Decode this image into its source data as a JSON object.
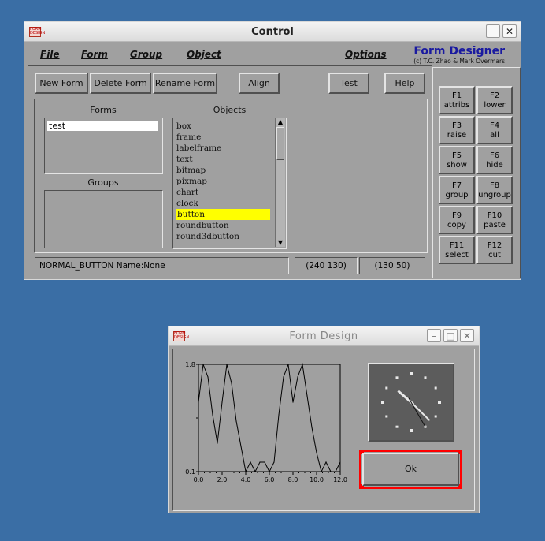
{
  "control": {
    "title": "Control",
    "menu": [
      "File",
      "Form",
      "Group",
      "Object",
      "Options"
    ],
    "brand": {
      "name": "Form Designer",
      "credit": "(c) T.C. Zhao & Mark Overmars"
    },
    "toolbar": [
      "New Form",
      "Delete Form",
      "Rename Form",
      "Align",
      "Test",
      "Help"
    ],
    "forms_label": "Forms",
    "objects_label": "Objects",
    "groups_label": "Groups",
    "forms": [
      "test"
    ],
    "objects": [
      "box",
      "frame",
      "labelframe",
      "text",
      "bitmap",
      "pixmap",
      "chart",
      "clock",
      "button",
      "roundbutton",
      "round3dbutton"
    ],
    "selected_object": "button",
    "status": {
      "info": "NORMAL_BUTTON Name:None",
      "pos": "(240 130)",
      "size": "(130 50)"
    },
    "fkeys": [
      {
        "key": "F1",
        "label": "attribs"
      },
      {
        "key": "F2",
        "label": "lower"
      },
      {
        "key": "F3",
        "label": "raise"
      },
      {
        "key": "F4",
        "label": "all"
      },
      {
        "key": "F5",
        "label": "show"
      },
      {
        "key": "F6",
        "label": "hide"
      },
      {
        "key": "F7",
        "label": "group"
      },
      {
        "key": "F8",
        "label": "ungroup"
      },
      {
        "key": "F9",
        "label": "copy"
      },
      {
        "key": "F10",
        "label": "paste"
      },
      {
        "key": "F11",
        "label": "select"
      },
      {
        "key": "F12",
        "label": "cut"
      }
    ]
  },
  "design": {
    "title": "Form Design",
    "ok_label": "Ok",
    "clock": {
      "hour": 10,
      "minute": 22,
      "second": 25
    }
  },
  "chart_data": {
    "type": "line",
    "x": [
      0.0,
      0.4,
      0.8,
      1.2,
      1.6,
      2.0,
      2.4,
      2.8,
      3.2,
      3.6,
      4.0,
      4.4,
      4.8,
      5.2,
      5.6,
      6.0,
      6.4,
      6.8,
      7.2,
      7.6,
      8.0,
      8.4,
      8.8,
      9.2,
      9.6,
      10.0,
      10.4,
      10.8,
      11.2,
      11.6,
      12.0
    ],
    "values": [
      1.2,
      1.8,
      1.6,
      1.0,
      0.55,
      1.2,
      1.8,
      1.5,
      0.9,
      0.5,
      0.1,
      0.25,
      0.1,
      0.25,
      0.25,
      0.1,
      0.25,
      1.0,
      1.6,
      1.8,
      1.2,
      1.6,
      1.8,
      1.3,
      0.8,
      0.4,
      0.1,
      0.25,
      0.1,
      0.1,
      0.25
    ],
    "yticks": [
      "1.8",
      "0.1"
    ],
    "xticks": [
      "0.0",
      "2.0",
      "4.0",
      "6.0",
      "8.0",
      "10.0",
      "12.0"
    ],
    "xlim": [
      0,
      12
    ],
    "ylim": [
      0.1,
      1.8
    ]
  }
}
